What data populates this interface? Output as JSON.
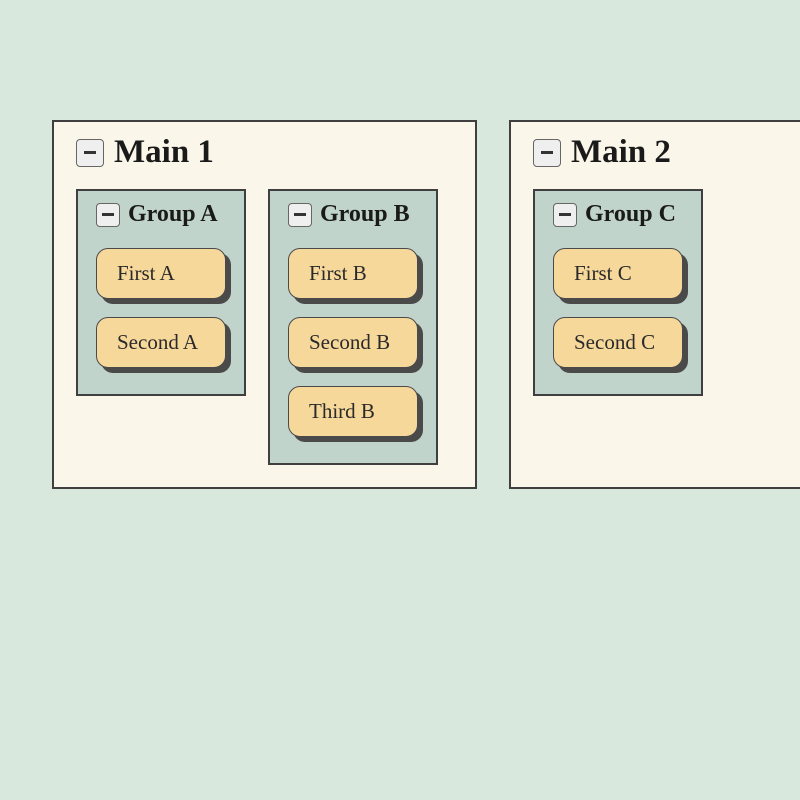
{
  "mains": [
    {
      "id": "main-1",
      "title": "Main 1",
      "groups": [
        {
          "id": "group-a",
          "title": "Group A",
          "items": [
            "First A",
            "Second A"
          ]
        },
        {
          "id": "group-b",
          "title": "Group B",
          "items": [
            "First B",
            "Second B",
            "Third B"
          ]
        }
      ]
    },
    {
      "id": "main-2",
      "title": "Main 2",
      "groups": [
        {
          "id": "group-c",
          "title": "Group C",
          "items": [
            "First C",
            "Second C"
          ]
        }
      ]
    }
  ]
}
